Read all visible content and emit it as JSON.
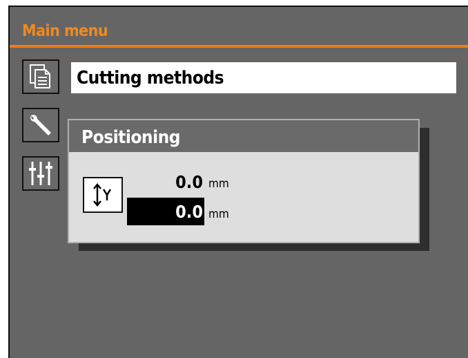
{
  "header": {
    "title": "Main menu"
  },
  "sidebar": {
    "items": [
      {
        "icon": "document-icon"
      },
      {
        "icon": "wrench-icon"
      },
      {
        "icon": "sliders-icon"
      }
    ]
  },
  "menu": {
    "selected_item": "Cutting methods"
  },
  "positioning_dialog": {
    "title": "Positioning",
    "axis_icon": "y-axis-icon",
    "current_value": "0.0",
    "current_unit": "mm",
    "input_value": "0.0",
    "input_unit": "mm"
  },
  "colors": {
    "background": "#656565",
    "accent": "#f07d14",
    "dialog_bg": "#dedede",
    "field_bg": "#ffffff"
  }
}
